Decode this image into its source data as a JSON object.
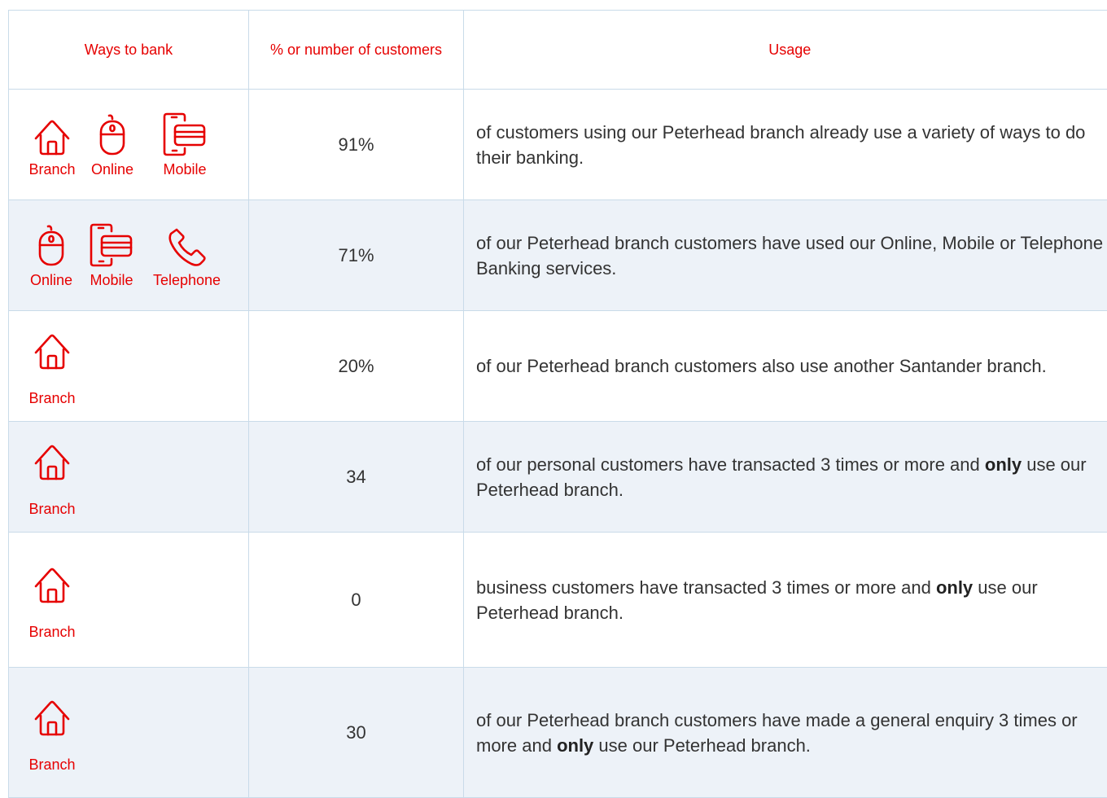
{
  "table": {
    "headers": [
      "Ways to bank",
      "% or number of customers",
      "Usage"
    ],
    "rows": [
      {
        "channels": [
          "Branch",
          "Online",
          "Mobile"
        ],
        "icons": [
          "house-icon",
          "mouse-icon",
          "mobile-card-icon"
        ],
        "value": "91%",
        "usage_pre": "of customers using our Peterhead branch already use a variety of ways to do their banking.",
        "usage_bold": "",
        "usage_post": ""
      },
      {
        "channels": [
          "Online",
          "Mobile",
          "Telephone"
        ],
        "icons": [
          "mouse-icon",
          "mobile-card-icon",
          "phone-icon"
        ],
        "value": "71%",
        "usage_pre": "of our Peterhead branch customers have used our Online, Mobile or Telephone Banking services.",
        "usage_bold": "",
        "usage_post": ""
      },
      {
        "channels": [
          "Branch"
        ],
        "icons": [
          "house-icon"
        ],
        "value": "20%",
        "usage_pre": "of our Peterhead branch customers also use another Santander branch.",
        "usage_bold": "",
        "usage_post": ""
      },
      {
        "channels": [
          "Branch"
        ],
        "icons": [
          "house-icon"
        ],
        "value": "34",
        "usage_pre": "of our personal customers have transacted 3 times or more and ",
        "usage_bold": "only",
        "usage_post": " use our Peterhead branch."
      },
      {
        "channels": [
          "Branch"
        ],
        "icons": [
          "house-icon"
        ],
        "value": "0",
        "usage_pre": "business customers have transacted 3 times or more and ",
        "usage_bold": "only",
        "usage_post": " use our Peterhead branch."
      },
      {
        "channels": [
          "Branch"
        ],
        "icons": [
          "house-icon"
        ],
        "value": "30",
        "usage_pre": "of our Peterhead branch customers have made a general enquiry 3 times or more and ",
        "usage_bold": "only",
        "usage_post": " use our Peterhead branch."
      }
    ]
  },
  "colors": {
    "accent": "#e60000",
    "alt_row": "#edf2f8",
    "border": "#c9dbe9",
    "text": "#333333"
  }
}
